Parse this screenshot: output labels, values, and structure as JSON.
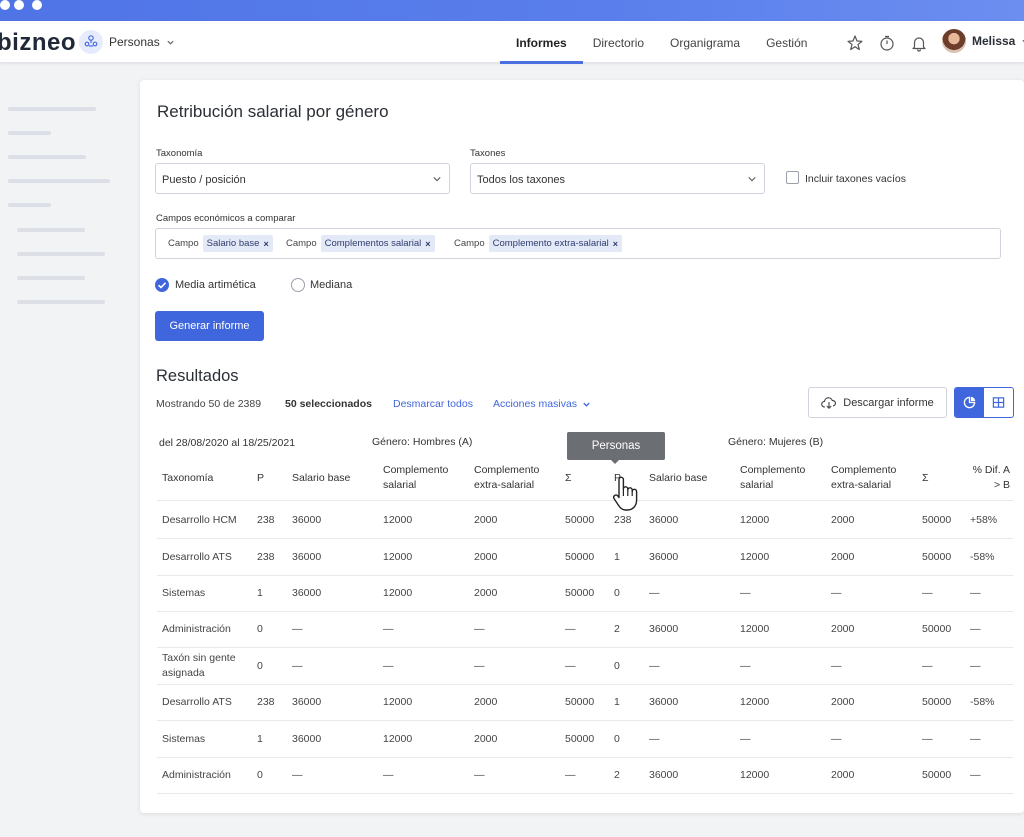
{
  "app": {
    "logo": "bizneo",
    "module": "Personas",
    "nav_tabs": [
      {
        "label": "Informes",
        "active": true
      },
      {
        "label": "Directorio",
        "active": false
      },
      {
        "label": "Organigrama",
        "active": false
      },
      {
        "label": "Gestión",
        "active": false
      }
    ],
    "nav_icons": [
      "star-icon",
      "timer-icon",
      "bell-icon"
    ],
    "user_name": "Melissa",
    "accent_color": "#3f66dd"
  },
  "report": {
    "title": "Retribución salarial por género",
    "taxonomy_label": "Taxonomía",
    "taxonomy_value": "Puesto / posición",
    "taxons_label": "Taxones",
    "taxons_value": "Todos los taxones",
    "include_empty_label": "Incluir taxones vacíos",
    "include_empty_checked": false,
    "fields_label": "Campos económicos a comparar",
    "fields": [
      {
        "prefix": "Campo",
        "value": "Salario base"
      },
      {
        "prefix": "Campo",
        "value": "Complementos salarial"
      },
      {
        "prefix": "Campo",
        "value": "Complemento extra-salarial"
      }
    ],
    "chip_remove": "×",
    "aggregation": [
      {
        "label": "Media artimética",
        "selected": true
      },
      {
        "label": "Mediana",
        "selected": false
      }
    ],
    "generate_button": "Generar informe"
  },
  "results": {
    "title": "Resultados",
    "showing": "Mostrando 50 de 2389",
    "selected": "50 seleccionados",
    "unselect_all": "Desmarcar todos",
    "bulk_actions": "Acciones masivas",
    "download_button": "Descargar informe",
    "date_range": "del 28/08/2020 al 18/25/2021",
    "group_a": "Género: Hombres (A)",
    "group_b": "Género: Mujeres (B)",
    "tooltip": "Personas",
    "headers": {
      "taxonomy": "Taxonomía",
      "p_a": "P",
      "base_a": "Salario base",
      "comp_a": "Complemento salarial",
      "extra_a": "Complemento extra-salarial",
      "sum_a": "Σ",
      "p_b": "P",
      "base_b": "Salario base",
      "comp_b": "Complemento salarial",
      "extra_b": "Complemento extra-salarial",
      "sum_b": "Σ",
      "diff": "% Dif. A > B"
    },
    "rows": [
      {
        "taxonomy": "Desarrollo HCM",
        "p_a": "238",
        "base_a": "36000",
        "comp_a": "12000",
        "extra_a": "2000",
        "sum_a": "50000",
        "p_b": "238",
        "base_b": "36000",
        "comp_b": "12000",
        "extra_b": "2000",
        "sum_b": "50000",
        "diff": "+58%"
      },
      {
        "taxonomy": "Desarrollo ATS",
        "p_a": "238",
        "base_a": "36000",
        "comp_a": "12000",
        "extra_a": "2000",
        "sum_a": "50000",
        "p_b": "1",
        "base_b": "36000",
        "comp_b": "12000",
        "extra_b": "2000",
        "sum_b": "50000",
        "diff": "-58%"
      },
      {
        "taxonomy": "Sistemas",
        "p_a": "1",
        "base_a": "36000",
        "comp_a": "12000",
        "extra_a": "2000",
        "sum_a": "50000",
        "p_b": "0",
        "base_b": "—",
        "comp_b": "—",
        "extra_b": "—",
        "sum_b": "—",
        "diff": "—"
      },
      {
        "taxonomy": "Administración",
        "p_a": "0",
        "base_a": "—",
        "comp_a": "—",
        "extra_a": "—",
        "sum_a": "—",
        "p_b": "2",
        "base_b": "36000",
        "comp_b": "12000",
        "extra_b": "2000",
        "sum_b": "50000",
        "diff": "—"
      },
      {
        "taxonomy": "Taxón sin gente asignada",
        "p_a": "0",
        "base_a": "—",
        "comp_a": "—",
        "extra_a": "—",
        "sum_a": "—",
        "p_b": "0",
        "base_b": "—",
        "comp_b": "—",
        "extra_b": "—",
        "sum_b": "—",
        "diff": "—"
      },
      {
        "taxonomy": "Desarrollo ATS",
        "p_a": "238",
        "base_a": "36000",
        "comp_a": "12000",
        "extra_a": "2000",
        "sum_a": "50000",
        "p_b": "1",
        "base_b": "36000",
        "comp_b": "12000",
        "extra_b": "2000",
        "sum_b": "50000",
        "diff": "-58%"
      },
      {
        "taxonomy": "Sistemas",
        "p_a": "1",
        "base_a": "36000",
        "comp_a": "12000",
        "extra_a": "2000",
        "sum_a": "50000",
        "p_b": "0",
        "base_b": "—",
        "comp_b": "—",
        "extra_b": "—",
        "sum_b": "—",
        "diff": "—"
      },
      {
        "taxonomy": "Administración",
        "p_a": "0",
        "base_a": "—",
        "comp_a": "—",
        "extra_a": "—",
        "sum_a": "—",
        "p_b": "2",
        "base_b": "36000",
        "comp_b": "12000",
        "extra_b": "2000",
        "sum_b": "50000",
        "diff": "—"
      }
    ]
  }
}
